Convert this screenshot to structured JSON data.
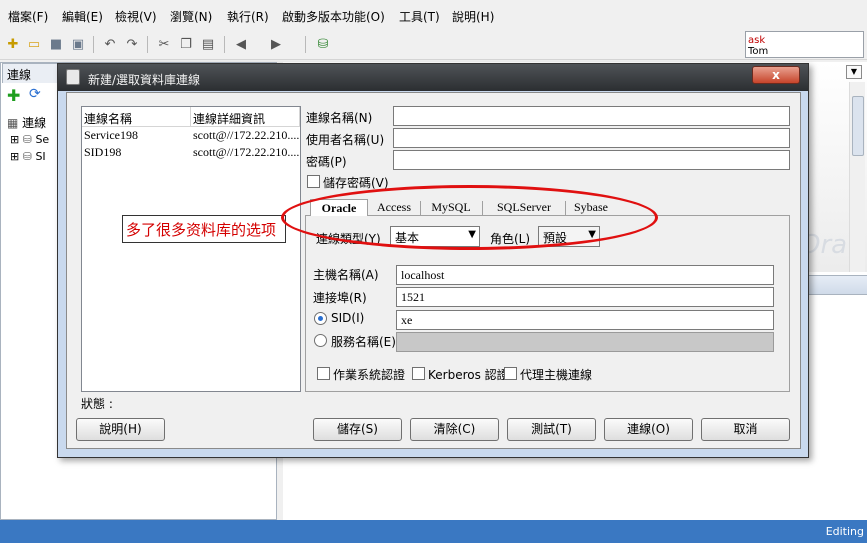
{
  "menu": [
    "檔案(F)",
    "編輯(E)",
    "檢視(V)",
    "瀏覽(N)",
    "執行(R)",
    "啟動多版本功能(O)",
    "工具(T)",
    "說明(H)"
  ],
  "toolbar": {
    "icons": [
      "new-icon",
      "open-folder-icon",
      "save-icon",
      "save-all-icon",
      "undo-icon",
      "redo-icon",
      "cut-icon",
      "copy-icon",
      "paste-icon",
      "back-icon",
      "forward-icon",
      "sql-icon"
    ],
    "ask_box": {
      "line1": "ask",
      "line2": "Tom"
    }
  },
  "left_panel": {
    "tab": "連線",
    "root": "連線",
    "nodes": [
      "Se",
      "SI"
    ]
  },
  "dialog": {
    "title": "新建/選取資料庫連線",
    "close": "x",
    "list": {
      "headers": [
        "連線名稱",
        "連線詳細資訊"
      ],
      "rows": [
        {
          "name": "Service198",
          "detail": "scott@//172.22.210...."
        },
        {
          "name": "SID198",
          "detail": "scott@//172.22.210...."
        }
      ]
    },
    "status_label": "狀態 :",
    "form": {
      "conn_name_label": "連線名稱(N)",
      "conn_name_value": "",
      "user_label": "使用者名稱(U)",
      "user_value": "",
      "password_label": "密碼(P)",
      "password_value": "",
      "save_password_label": "儲存密碼(V)",
      "save_password_checked": false
    },
    "tabs": [
      "Oracle",
      "Access",
      "MySQL",
      "SQLServer",
      "Sybase"
    ],
    "active_tab": "Oracle",
    "oracle": {
      "conn_type_label": "連線類型(Y)",
      "conn_type_value": "基本",
      "role_label": "角色(L)",
      "role_value": "預設",
      "host_label": "主機名稱(A)",
      "host_value": "localhost",
      "port_label": "連接埠(R)",
      "port_value": "1521",
      "sid_label": "SID(I)",
      "sid_value": "xe",
      "service_label": "服務名稱(E)",
      "service_value": "",
      "selected_option": "SID",
      "os_auth_label": "作業系統認證",
      "kerberos_label": "Kerberos 認證",
      "proxy_label": "代理主機連線"
    },
    "buttons": {
      "help": "說明(H)",
      "save": "儲存(S)",
      "clear": "清除(C)",
      "test": "測試(T)",
      "connect": "連線(O)",
      "cancel": "取消"
    }
  },
  "annotation": {
    "note": "多了很多资料库的选项",
    "color": "#e01010"
  },
  "watermark": "Ora",
  "status_bar": {
    "text": "Editing"
  }
}
